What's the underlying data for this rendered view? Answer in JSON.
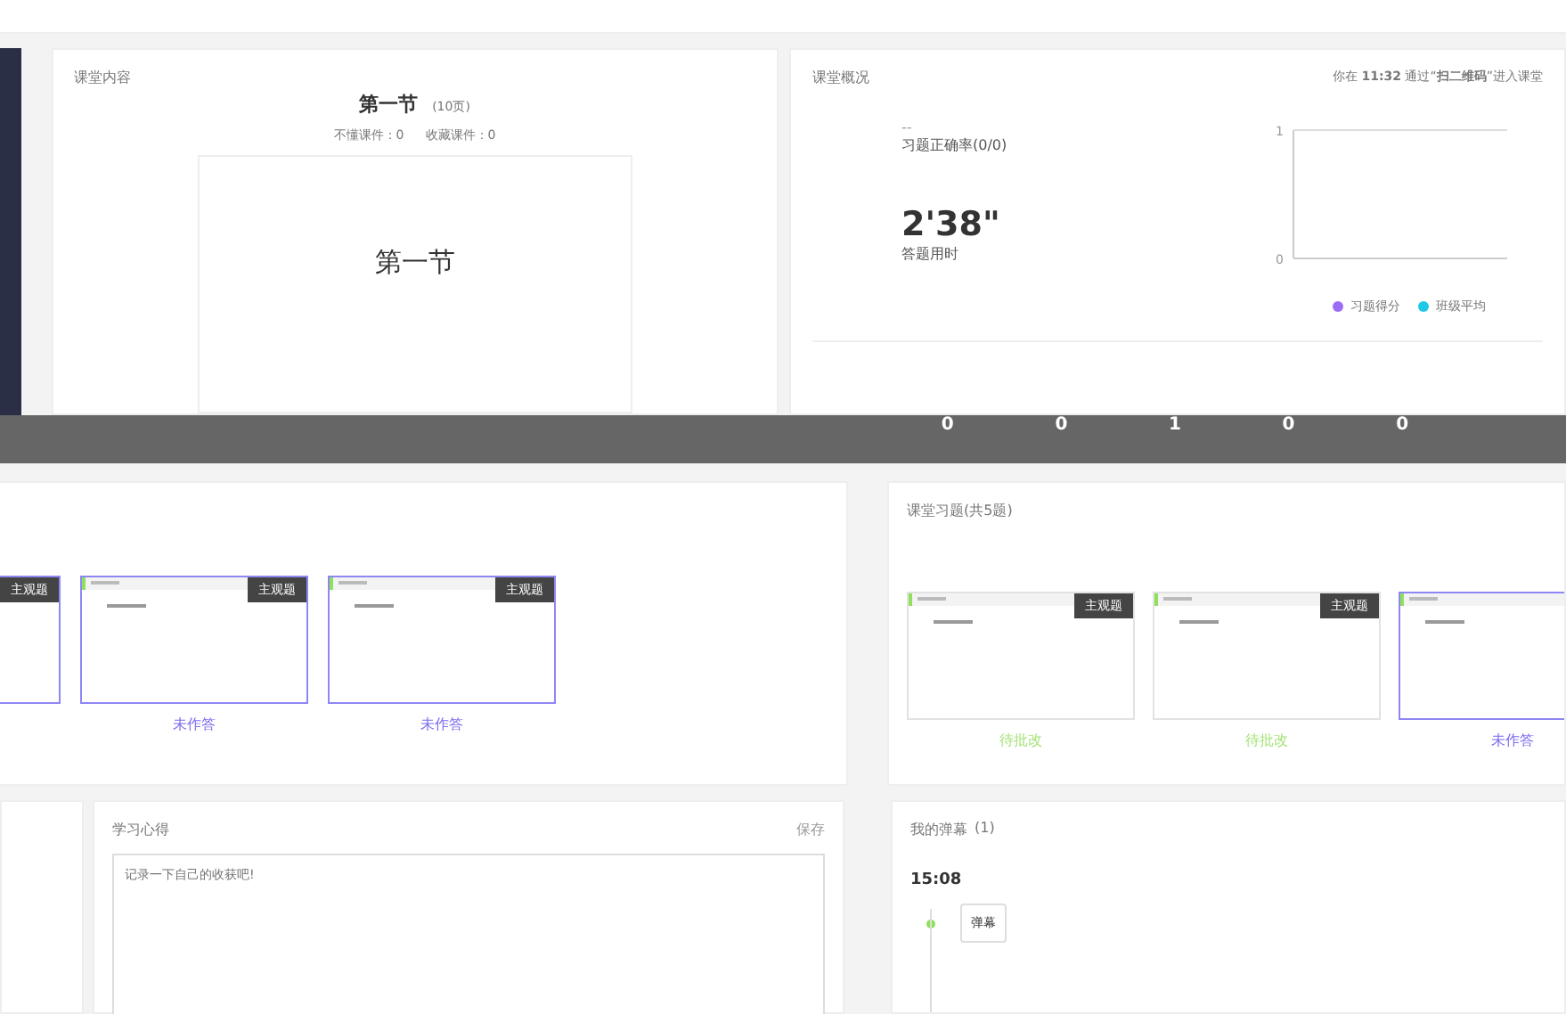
{
  "content_panel": {
    "title": "课堂内容",
    "lesson_title": "第一节",
    "page_count": "(10页)",
    "stats": [
      "不懂课件：0",
      "收藏课件：0"
    ],
    "slide_text": "第一节"
  },
  "overview_panel": {
    "title": "课堂概况",
    "entry_note": "你在 **11:32** 通过“**扫二维码**”进入课堂",
    "accuracy_value": "--",
    "accuracy_label": "习题正确率(0/0)",
    "time_value": "2'38\"",
    "time_label": "答题用时",
    "chart_data": {
      "type": "line",
      "ylim": [
        0,
        1
      ],
      "yticks": [
        0,
        1
      ],
      "series": [
        {
          "name": "习题得分",
          "color": "#9b6cf5"
        },
        {
          "name": "班级平均",
          "color": "#1ec8e6"
        }
      ]
    }
  },
  "stats_strip": [
    "0",
    "0",
    "1",
    "0",
    "0"
  ],
  "left_exercises": {
    "cards": [
      {
        "tag": "主观题",
        "kind": "unanswered"
      },
      {
        "tag": "主观题",
        "status": "未作答",
        "kind": "unanswered"
      },
      {
        "tag": "主观题",
        "status": "未作答",
        "kind": "unanswered"
      }
    ]
  },
  "exercises_panel": {
    "title": "课堂习题(共5题)",
    "cards": [
      {
        "tag": "主观题",
        "status": "待批改",
        "kind": "pending"
      },
      {
        "tag": "主观题",
        "status": "待批改",
        "kind": "pending"
      },
      {
        "status": "未作答",
        "kind": "unanswered"
      }
    ]
  },
  "notes_panel": {
    "title": "学习心得",
    "save": "保存",
    "placeholder": "记录一下自己的收获吧!"
  },
  "danmaku_panel": {
    "title": "我的弹幕",
    "count": "(1)",
    "time": "15:08",
    "message": "弹幕"
  }
}
